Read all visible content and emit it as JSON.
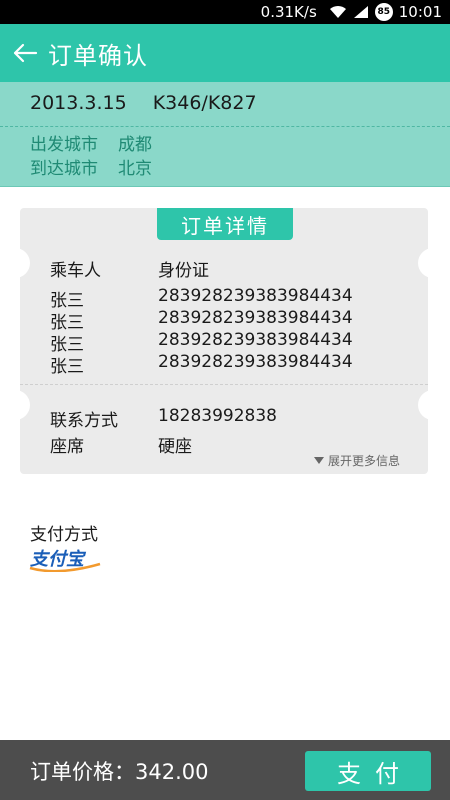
{
  "status_bar": {
    "speed": "0.31K/s",
    "battery": "85",
    "time": "10:01"
  },
  "header": {
    "title": "订单确认"
  },
  "trip": {
    "date": "2013.3.15",
    "train": "K346/K827",
    "depart_label": "出发城市",
    "depart_city": "成都",
    "arrive_label": "到达城市",
    "arrive_city": "北京"
  },
  "details": {
    "tag": "订单详情",
    "passenger_header": "乘车人",
    "id_header": "身份证",
    "passengers": [
      {
        "name": "张三",
        "id": "283928239383984434"
      },
      {
        "name": "张三",
        "id": "283928239383984434"
      },
      {
        "name": "张三",
        "id": "283928239383984434"
      },
      {
        "name": "张三",
        "id": "283928239383984434"
      }
    ],
    "contact_label": "联系方式",
    "contact_value": "18283992838",
    "seat_label": "座席",
    "seat_value": "硬座",
    "expand_label": "展开更多信息"
  },
  "payment": {
    "label": "支付方式",
    "method_logo": "支付宝"
  },
  "bottom": {
    "price": "订单价格：342.00",
    "pay_button": "支付"
  },
  "colors": {
    "accent": "#2ec5aa",
    "trip_bg": "#8ad8c9",
    "city_text": "#1f8a74",
    "card_bg": "#ebebeb",
    "bottom_bg": "#4d4d4d"
  }
}
